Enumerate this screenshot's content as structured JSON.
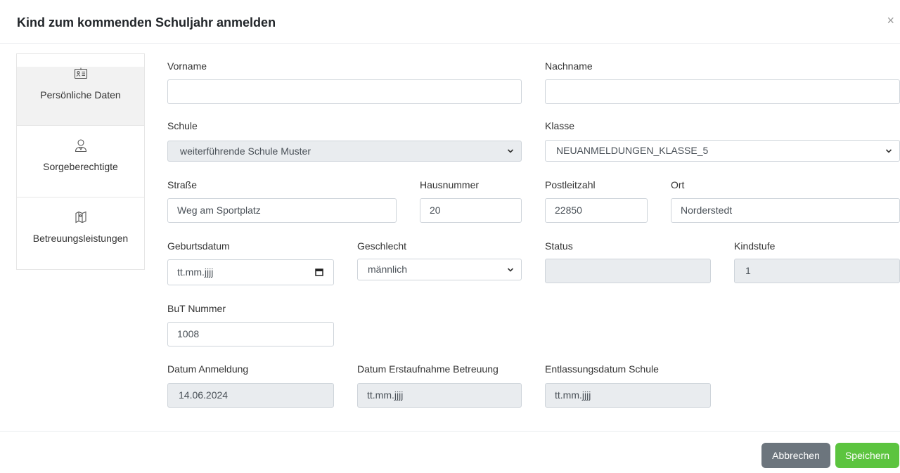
{
  "dialog": {
    "title": "Kind zum kommenden Schuljahr anmelden",
    "close": "×"
  },
  "nav": {
    "items": [
      {
        "label": "Persönliche Daten",
        "icon": "id-card-icon"
      },
      {
        "label": "Sorgeberechtigte",
        "icon": "person-icon"
      },
      {
        "label": "Betreuungsleistungen",
        "icon": "map-icon"
      }
    ]
  },
  "form": {
    "vorname": {
      "label": "Vorname",
      "value": ""
    },
    "nachname": {
      "label": "Nachname",
      "value": ""
    },
    "schule": {
      "label": "Schule",
      "value": "weiterführende Schule Muster"
    },
    "klasse": {
      "label": "Klasse",
      "value": "NEUANMELDUNGEN_KLASSE_5"
    },
    "strasse": {
      "label": "Straße",
      "value": "Weg am Sportplatz"
    },
    "hausnummer": {
      "label": "Hausnummer",
      "value": "20"
    },
    "plz": {
      "label": "Postleitzahl",
      "value": "22850"
    },
    "ort": {
      "label": "Ort",
      "value": "Norderstedt"
    },
    "geburtsdatum": {
      "label": "Geburtsdatum",
      "value": "tt.mm.jjjj"
    },
    "geschlecht": {
      "label": "Geschlecht",
      "value": "männlich"
    },
    "status": {
      "label": "Status",
      "value": ""
    },
    "kindstufe": {
      "label": "Kindstufe",
      "value": "1"
    },
    "but": {
      "label": "BuT Nummer",
      "value": "1008"
    },
    "anmeldung": {
      "label": "Datum Anmeldung",
      "value": "14.06.2024"
    },
    "erstaufnahme": {
      "label": "Datum Erstaufnahme Betreuung",
      "value": "tt.mm.jjjj"
    },
    "entlassung": {
      "label": "Entlassungsdatum Schule",
      "value": "tt.mm.jjjj"
    }
  },
  "footer": {
    "cancel": "Abbrechen",
    "save": "Speichern"
  },
  "colors": {
    "cancel": "#6c757d",
    "save": "#5cc43f",
    "readonly": "#e9ecef"
  }
}
